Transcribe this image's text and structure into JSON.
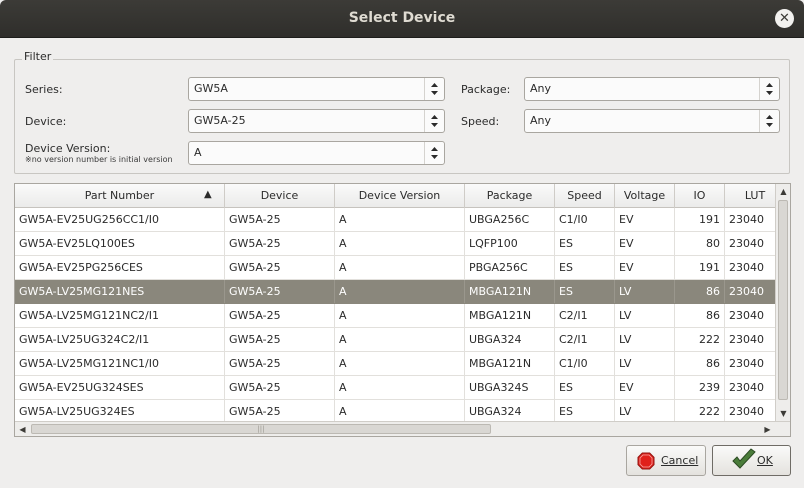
{
  "window": {
    "title": "Select Device"
  },
  "filter": {
    "legend": "Filter",
    "series_label": "Series:",
    "series_value": "GW5A",
    "device_label": "Device:",
    "device_value": "GW5A-25",
    "version_label": "Device Version:",
    "version_note": "※no version number is initial version",
    "version_value": "A",
    "package_label": "Package:",
    "package_value": "Any",
    "speed_label": "Speed:",
    "speed_value": "Any"
  },
  "table": {
    "columns": [
      "Part Number",
      "Device",
      "Device Version",
      "Package",
      "Speed",
      "Voltage",
      "IO",
      "LUT"
    ],
    "sorted_column": "Part Number",
    "sort_direction": "ascending",
    "selected_row": 3,
    "rows": [
      [
        "GW5A-EV25UG256CC1/I0",
        "GW5A-25",
        "A",
        "UBGA256C",
        "C1/I0",
        "EV",
        "191",
        "23040"
      ],
      [
        "GW5A-EV25LQ100ES",
        "GW5A-25",
        "A",
        "LQFP100",
        "ES",
        "EV",
        "80",
        "23040"
      ],
      [
        "GW5A-EV25PG256CES",
        "GW5A-25",
        "A",
        "PBGA256C",
        "ES",
        "EV",
        "191",
        "23040"
      ],
      [
        "GW5A-LV25MG121NES",
        "GW5A-25",
        "A",
        "MBGA121N",
        "ES",
        "LV",
        "86",
        "23040"
      ],
      [
        "GW5A-LV25MG121NC2/I1",
        "GW5A-25",
        "A",
        "MBGA121N",
        "C2/I1",
        "LV",
        "86",
        "23040"
      ],
      [
        "GW5A-LV25UG324C2/I1",
        "GW5A-25",
        "A",
        "UBGA324",
        "C2/I1",
        "LV",
        "222",
        "23040"
      ],
      [
        "GW5A-LV25MG121NC1/I0",
        "GW5A-25",
        "A",
        "MBGA121N",
        "C1/I0",
        "LV",
        "86",
        "23040"
      ],
      [
        "GW5A-EV25UG324SES",
        "GW5A-25",
        "A",
        "UBGA324S",
        "ES",
        "EV",
        "239",
        "23040"
      ],
      [
        "GW5A-LV25UG324ES",
        "GW5A-25",
        "A",
        "UBGA324",
        "ES",
        "LV",
        "222",
        "23040"
      ]
    ]
  },
  "buttons": {
    "cancel_label": "Cancel",
    "ok_label": "OK"
  },
  "icons": {
    "close": "close-icon",
    "sort": "sort-ascending-icon",
    "cancel": "stop-icon",
    "ok": "check-icon"
  },
  "colors": {
    "titlebar": "#3c3b37",
    "selected_row": "#8a877c",
    "cancel_icon": "#e0201b",
    "ok_icon": "#4a7c3a"
  }
}
